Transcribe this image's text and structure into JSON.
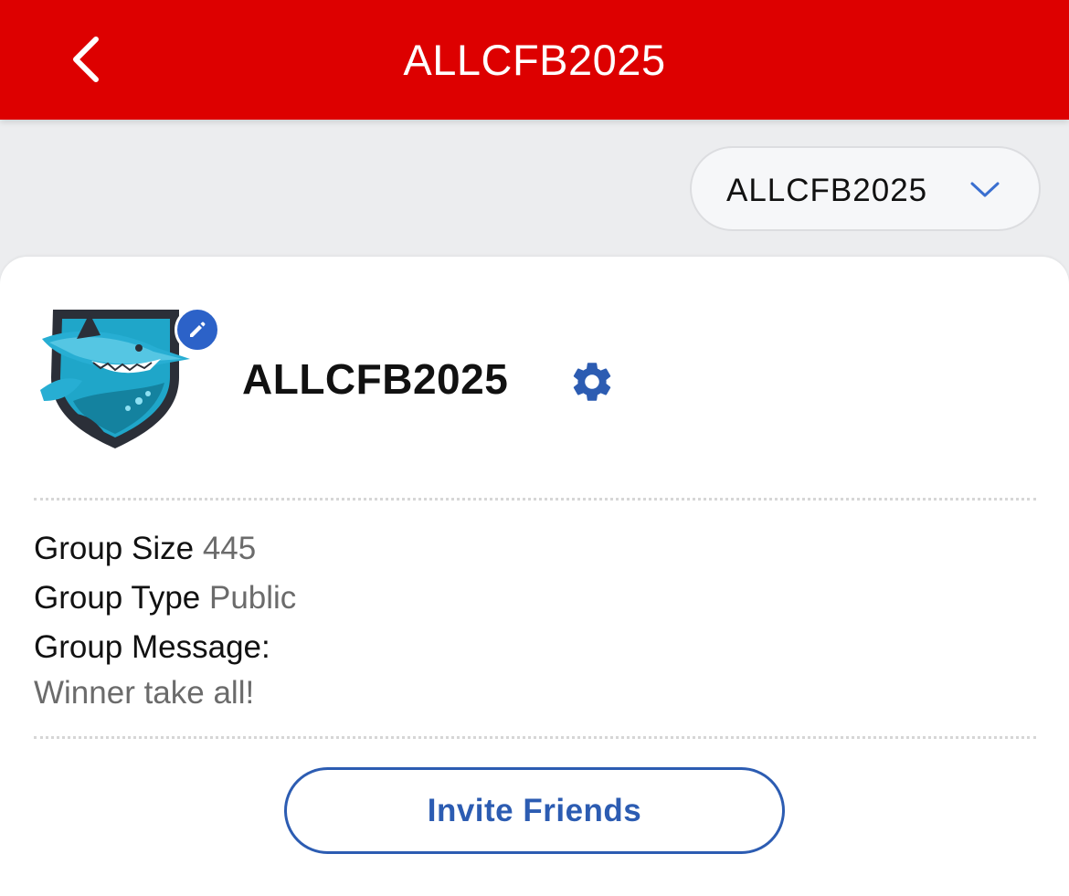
{
  "header": {
    "title": "ALLCFB2025",
    "background_color": "#dd0000",
    "back_icon": "chevron-left-icon"
  },
  "group_selector": {
    "selected": "ALLCFB2025",
    "icon": "chevron-down-icon"
  },
  "group": {
    "name": "ALLCFB2025",
    "logo": "shark-shield-logo",
    "edit_icon": "pencil-icon",
    "settings_icon": "gear-icon",
    "size_label": "Group Size",
    "size_value": "445",
    "type_label": "Group Type",
    "type_value": "Public",
    "message_label": "Group Message:",
    "message_value": "Winner take all!"
  },
  "actions": {
    "invite_label": "Invite Friends"
  },
  "colors": {
    "accent_blue": "#2c5cb2",
    "brand_red": "#dd0000"
  }
}
